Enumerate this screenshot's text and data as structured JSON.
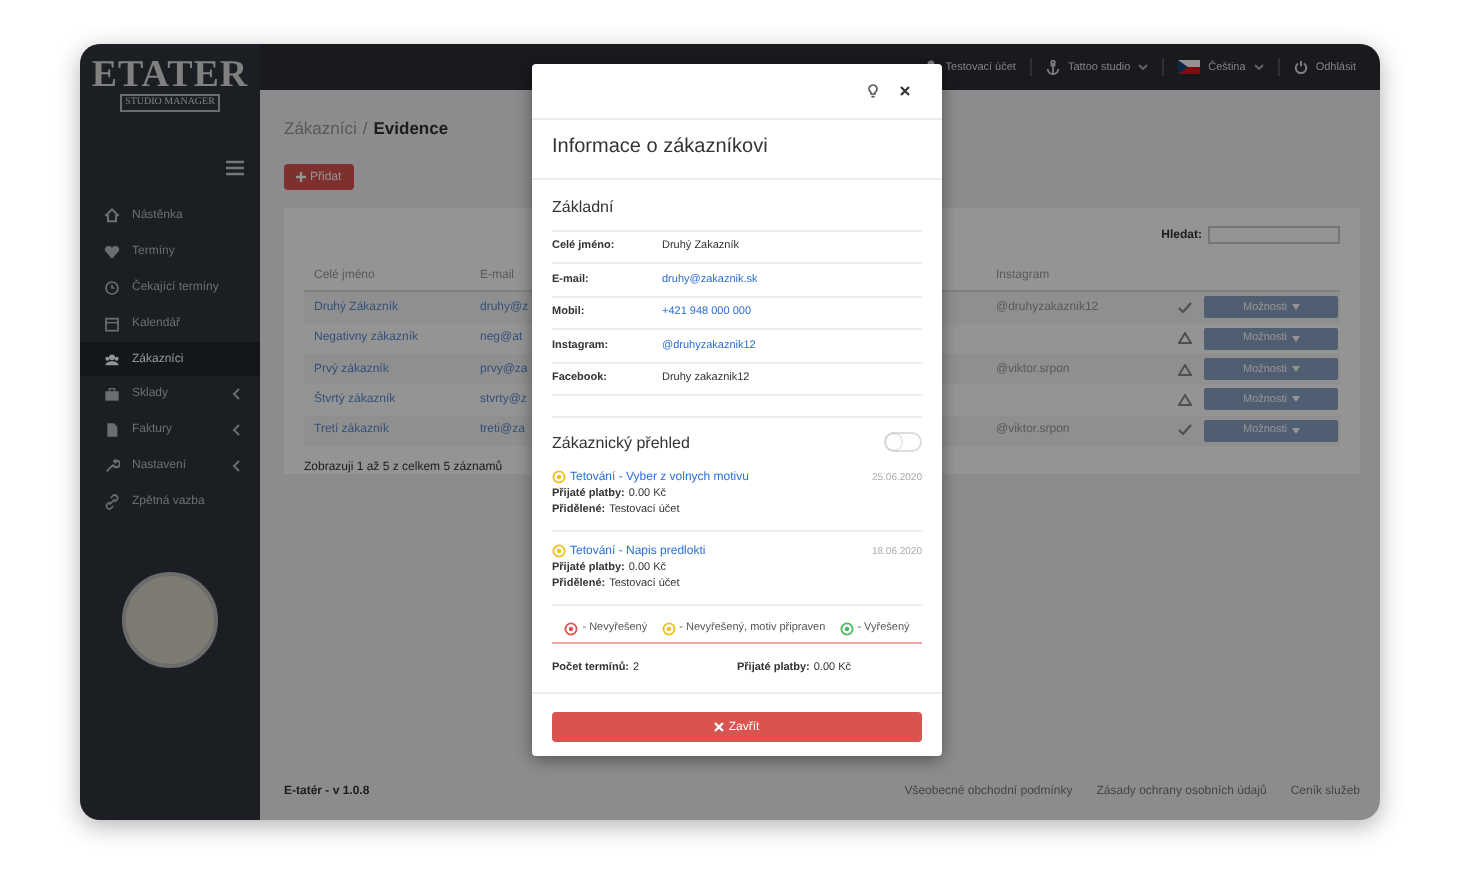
{
  "logo": {
    "title": "ETATER",
    "subtitle": "STUDIO MANAGER"
  },
  "sidebar": {
    "items": [
      {
        "label": "Nástěnka",
        "selected": false,
        "has_submenu": false
      },
      {
        "label": "Termíny",
        "selected": false,
        "has_submenu": false
      },
      {
        "label": "Čekající termíny",
        "selected": false,
        "has_submenu": false
      },
      {
        "label": "Kalendář",
        "selected": false,
        "has_submenu": false
      },
      {
        "label": "Zákazníci",
        "selected": true,
        "has_submenu": false
      },
      {
        "label": "Sklady",
        "selected": false,
        "has_submenu": true
      },
      {
        "label": "Faktury",
        "selected": false,
        "has_submenu": true
      },
      {
        "label": "Nastavení",
        "selected": false,
        "has_submenu": true
      },
      {
        "label": "Zpětná vazba",
        "selected": false,
        "has_submenu": false
      }
    ]
  },
  "topbar": {
    "user": "Testovací účet",
    "studio": "Tattoo studio",
    "language": "Čeština",
    "logout": "Odhlásit"
  },
  "breadcrumb": {
    "parent": "Zákazníci",
    "separator": "/",
    "current": "Evidence"
  },
  "add_button": "Přidat",
  "table": {
    "search_label": "Hledat:",
    "columns": [
      "Celé jméno",
      "E-mail",
      "Instagram"
    ],
    "rows": [
      {
        "name": "Druhý Zákazník",
        "email": "druhy@z",
        "instagram": "@druhyzakaznik12",
        "kind": "ok",
        "action": "Možnosti"
      },
      {
        "name": "Negativny zákazník",
        "email": "neg@at",
        "instagram": "",
        "kind": "warning",
        "action": "Možnosti"
      },
      {
        "name": "Prvý zákazník",
        "email": "prvy@za",
        "instagram": "@viktor.srpon",
        "kind": "warning",
        "action": "Možnosti"
      },
      {
        "name": "Štvrtý zákazník",
        "email": "stvrty@z",
        "instagram": "",
        "kind": "warning",
        "action": "Možnosti"
      },
      {
        "name": "Tretí zákazník",
        "email": "treti@za",
        "instagram": "@viktor.srpon",
        "kind": "ok",
        "action": "Možnosti"
      }
    ],
    "info": "Zobrazuji 1 až 5 z celkem 5 záznamů"
  },
  "footer": {
    "version": "E-tatér - v 1.0.8",
    "links": [
      "Všeobecné obchodní podmínky",
      "Zásady ochrany osobních údajů",
      "Ceník služeb"
    ]
  },
  "modal": {
    "title": "Informace o zákazníkovi",
    "section": "Základní",
    "fields": [
      {
        "label": "Celé jméno:",
        "value": "Druhý Zakazník",
        "kind": "text"
      },
      {
        "label": "E-mail:",
        "value": "druhy@zakaznik.sk",
        "kind": "link"
      },
      {
        "label": "Mobil:",
        "value": "+421 948 000 000",
        "kind": "link"
      },
      {
        "label": "Instagram:",
        "value": "@druhyzakaznik12",
        "kind": "link"
      },
      {
        "label": "Facebook:",
        "value": "Druhy zakaznik12",
        "kind": "text"
      }
    ],
    "overview": {
      "title": "Zákaznický přehled",
      "on": false
    },
    "appointments": [
      {
        "title": "Tetování - Vyber z volnych motivu",
        "date": "25.06.2020",
        "kind": "prepared",
        "payments_label": "Přijaté platby:",
        "payments": "0.00 Kč",
        "assigned_label": "Přidělené:",
        "assigned": "Testovací účet"
      },
      {
        "title": "Tetování - Napis predlokti",
        "date": "18.06.2020",
        "kind": "prepared",
        "payments_label": "Přijaté platby:",
        "payments": "0.00 Kč",
        "assigned_label": "Přidělené:",
        "assigned": "Testovací účet"
      }
    ],
    "legend": [
      {
        "label": "- Nevyřešený",
        "kind": "unresolved"
      },
      {
        "label": "- Nevyřešený, motiv připraven",
        "kind": "prepared"
      },
      {
        "label": "- Vyřešený",
        "kind": "resolved"
      }
    ],
    "summary": [
      {
        "label": "Počet termínů:",
        "value": "2"
      },
      {
        "label": "Přijaté platby:",
        "value": "0.00 Kč"
      }
    ],
    "close_button": "Zavřít"
  }
}
